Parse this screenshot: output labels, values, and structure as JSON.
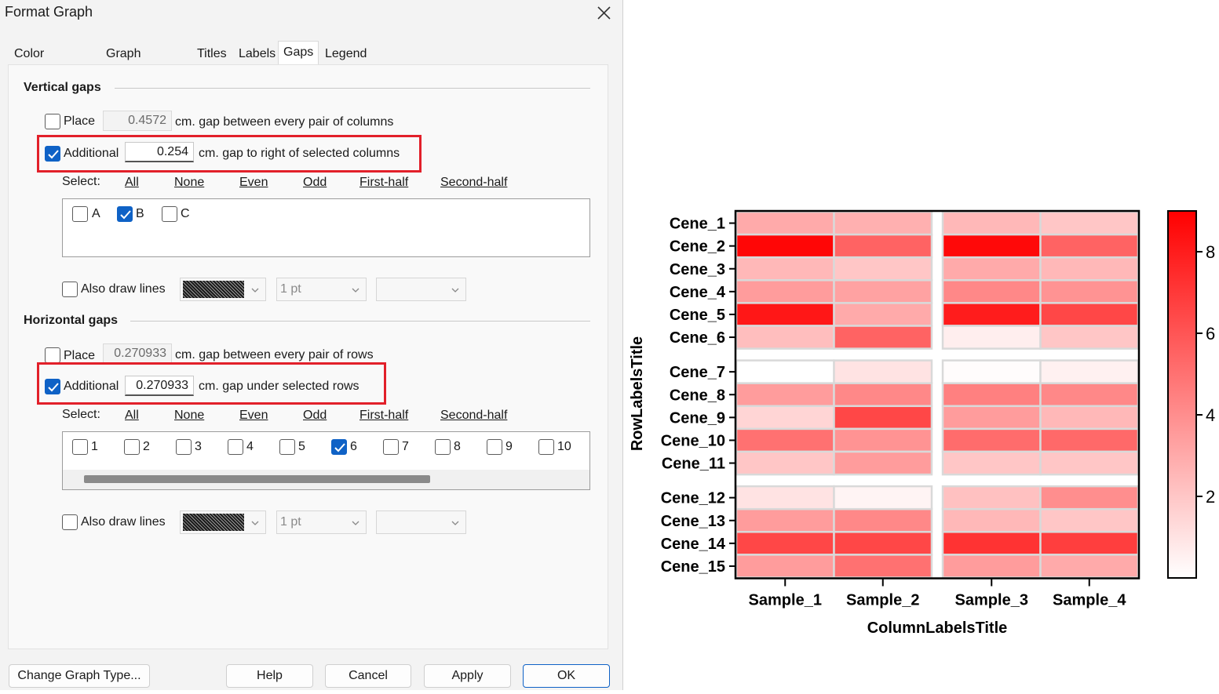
{
  "dialog": {
    "title": "Format Graph",
    "tabs": [
      "Color mapping",
      "Graph Settings",
      "Titles",
      "Labels",
      "Gaps",
      "Legend"
    ],
    "active_tab": "Gaps",
    "vertical": {
      "title": "Vertical gaps",
      "place_label": "Place",
      "place_value": "0.4572",
      "place_desc": "cm. gap between every pair of columns",
      "additional_label": "Additional",
      "additional_value": "0.254",
      "additional_desc": "cm. gap to right of selected columns",
      "select_label": "Select:",
      "select_links": [
        "All",
        "None",
        "Even",
        "Odd",
        "First-half",
        "Second-half"
      ],
      "items": [
        {
          "label": "A",
          "checked": false
        },
        {
          "label": "B",
          "checked": true
        },
        {
          "label": "C",
          "checked": false
        }
      ],
      "draw_lines_label": "Also draw lines",
      "line_width": "1 pt"
    },
    "horizontal": {
      "title": "Horizontal gaps",
      "place_label": "Place",
      "place_value": "0.270933",
      "place_desc": "cm. gap between every pair of rows",
      "additional_label": "Additional",
      "additional_value": "0.270933",
      "additional_desc": "cm. gap under selected rows",
      "select_label": "Select:",
      "select_links": [
        "All",
        "None",
        "Even",
        "Odd",
        "First-half",
        "Second-half"
      ],
      "items": [
        {
          "label": "1",
          "checked": false
        },
        {
          "label": "2",
          "checked": false
        },
        {
          "label": "3",
          "checked": false
        },
        {
          "label": "4",
          "checked": false
        },
        {
          "label": "5",
          "checked": false
        },
        {
          "label": "6",
          "checked": true
        },
        {
          "label": "7",
          "checked": false
        },
        {
          "label": "8",
          "checked": false
        },
        {
          "label": "9",
          "checked": false
        },
        {
          "label": "10",
          "checked": false
        }
      ],
      "draw_lines_label": "Also draw lines",
      "line_width": "1 pt"
    },
    "buttons": {
      "change_type": "Change Graph Type...",
      "help": "Help",
      "cancel": "Cancel",
      "apply": "Apply",
      "ok": "OK"
    },
    "colors": {
      "accent": "#0f62c6",
      "highlight": "#e2202a"
    }
  },
  "chart_data": {
    "type": "heatmap",
    "columns": [
      "Sample_1",
      "Sample_2",
      "Sample_3",
      "Sample_4"
    ],
    "rows": [
      "Cene_1",
      "Cene_2",
      "Cene_3",
      "Cene_4",
      "Cene_5",
      "Cene_6",
      "Cene_7",
      "Cene_8",
      "Cene_9",
      "Cene_10",
      "Cene_11",
      "Cene_12",
      "Cene_13",
      "Cene_14",
      "Cene_15"
    ],
    "values": [
      [
        3.0,
        2.8,
        2.5,
        2.0
      ],
      [
        8.8,
        5.5,
        8.7,
        5.5
      ],
      [
        2.5,
        2.0,
        3.0,
        2.5
      ],
      [
        3.5,
        3.3,
        4.2,
        3.8
      ],
      [
        8.2,
        3.0,
        8.0,
        6.5
      ],
      [
        2.3,
        5.5,
        0.6,
        2.0
      ],
      [
        0.0,
        1.0,
        0.1,
        0.5
      ],
      [
        3.5,
        4.2,
        4.5,
        4.2
      ],
      [
        1.5,
        6.5,
        3.5,
        2.5
      ],
      [
        5.0,
        3.8,
        5.2,
        5.3
      ],
      [
        2.0,
        3.5,
        2.0,
        2.0
      ],
      [
        1.0,
        0.4,
        2.2,
        4.0
      ],
      [
        3.5,
        4.2,
        2.5,
        2.0
      ],
      [
        6.5,
        6.5,
        7.2,
        6.8
      ],
      [
        3.5,
        5.0,
        3.5,
        3.0
      ]
    ],
    "column_gap_after": "Sample_2",
    "row_gap_after": [
      "Cene_6",
      "Cene_11"
    ],
    "xlabel": "ColumnLabelsTitle",
    "ylabel": "RowLabelsTitle",
    "color_range": [
      0,
      9
    ],
    "colorbar_ticks": [
      2,
      4,
      6,
      8
    ],
    "color_low": "#ffffff",
    "color_high": "#ff0000"
  }
}
